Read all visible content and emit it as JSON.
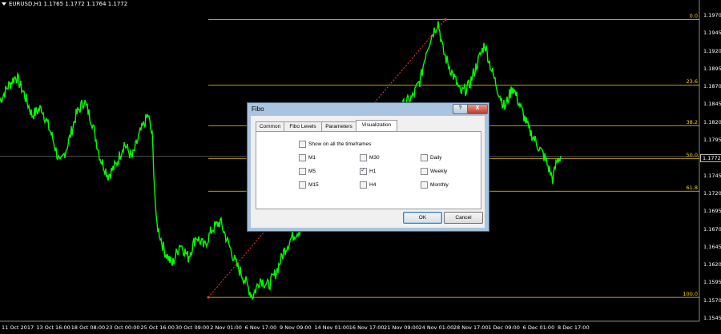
{
  "chart": {
    "symbol_header": "EURUSD,H1  1.1765 1.1772 1.1764 1.1772",
    "current_price": "1.1772",
    "price_ticks": [
      "1.1970",
      "1.1945",
      "1.1920",
      "1.1895",
      "1.1870",
      "1.1845",
      "1.1820",
      "1.1795",
      "1.1772",
      "1.1745",
      "1.1720",
      "1.1695",
      "1.1670",
      "1.1645",
      "1.1620",
      "1.1595",
      "1.1570",
      "1.1545"
    ],
    "fib_levels": [
      {
        "label": "0.0",
        "price": 1.1964
      },
      {
        "label": "23.6",
        "price": 1.1872
      },
      {
        "label": "38.2",
        "price": 1.1815
      },
      {
        "label": "50.0",
        "price": 1.1769
      },
      {
        "label": "61.8",
        "price": 1.1723
      },
      {
        "label": "100.0",
        "price": 1.1574
      }
    ],
    "time_ticks": [
      "11 Oct 2017",
      "13 Oct 16:00",
      "18 Oct 08:00",
      "23 Oct 00:00",
      "25 Oct 16:00",
      "30 Oct 09:00",
      "2 Nov 01:00",
      "6 Nov 17:00",
      "9 Nov 09:00",
      "14 Nov 01:00",
      "16 Nov 17:00",
      "21 Nov 09:00",
      "24 Nov 01:00",
      "28 Nov 17:00",
      "1 Dec 09:00",
      "6 Dec 01:00",
      "8 Dec 17:00"
    ],
    "colors": {
      "candles": "#00ff00",
      "fib": "#ffd700",
      "trend": "#ff3b30",
      "background": "#000000"
    }
  },
  "dialog": {
    "title": "Fibo",
    "help_label": "?",
    "close_label": "X",
    "tabs": [
      {
        "label": "Common",
        "active": false
      },
      {
        "label": "Fibo Levels",
        "active": false
      },
      {
        "label": "Parameters",
        "active": false
      },
      {
        "label": "Visualization",
        "active": true
      }
    ],
    "show_all_label": "Show on all the timeframes",
    "timeframes": [
      {
        "label": "M1",
        "checked": false
      },
      {
        "label": "M5",
        "checked": false
      },
      {
        "label": "M15",
        "checked": false
      },
      {
        "label": "M30",
        "checked": false
      },
      {
        "label": "H1",
        "checked": true
      },
      {
        "label": "H4",
        "checked": false
      },
      {
        "label": "Daily",
        "checked": false
      },
      {
        "label": "Weekly",
        "checked": false
      },
      {
        "label": "Monthly",
        "checked": false
      }
    ],
    "ok_label": "OK",
    "cancel_label": "Cancel"
  }
}
